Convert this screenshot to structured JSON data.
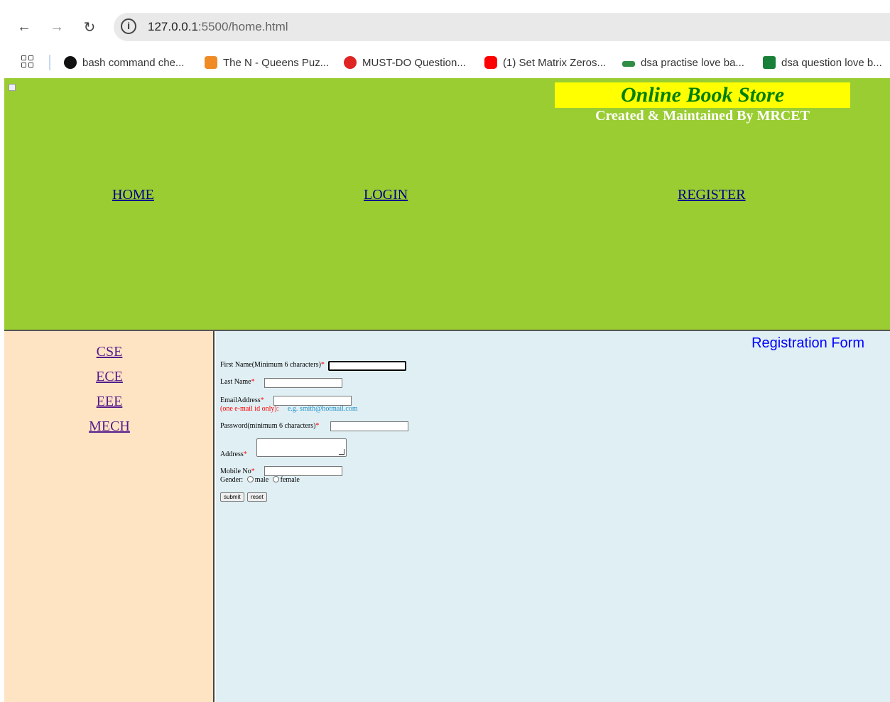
{
  "browser": {
    "url_host": "127.0.0.1",
    "url_rest": ":5500/home.html",
    "bookmarks": [
      {
        "label": "bash command che...",
        "color": "#111111"
      },
      {
        "label": "The N - Queens Puz...",
        "color": "#f08a24"
      },
      {
        "label": "MUST-DO Question...",
        "color": "#e02424"
      },
      {
        "label": "(1) Set Matrix Zeros...",
        "color": "#ff0000"
      },
      {
        "label": "dsa practise love ba...",
        "color": "#2f8d46"
      },
      {
        "label": "dsa question love b...",
        "color": "#188038"
      }
    ]
  },
  "header": {
    "title": "Online Book Store",
    "subtitle": "Created & Maintained By MRCET",
    "nav": {
      "home": "HOME",
      "login": "LOGIN",
      "register": "REGISTER"
    },
    "colors": {
      "background": "#9acd32",
      "title_bg": "#ffff00",
      "title_text": "#008000"
    }
  },
  "sidebar": {
    "links": [
      "CSE",
      "ECE",
      "EEE",
      "MECH"
    ]
  },
  "form": {
    "title": "Registration Form",
    "first_name_label": "First Name(Minimum 6 characters)",
    "last_name_label": "Last Name",
    "email_label": "EmailAddress",
    "email_hint": "(one e-mail id only):",
    "email_example": "e.g. smith@hotmail.com",
    "password_label": "Password(minimum 6 characters)",
    "address_label": "Address",
    "mobile_label": "Mobile No",
    "gender_label": "Gender:",
    "gender_male": "male",
    "gender_female": "female",
    "required_mark": "*",
    "submit_label": "submit",
    "reset_label": "reset"
  }
}
